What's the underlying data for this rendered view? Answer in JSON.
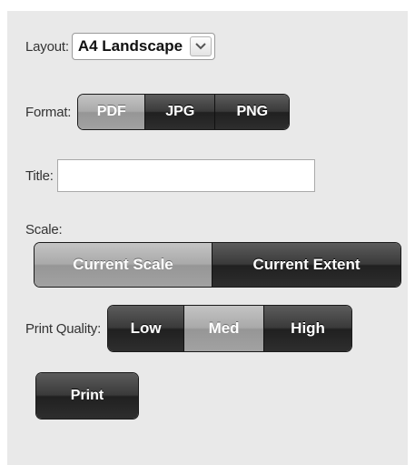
{
  "layout": {
    "label": "Layout:",
    "value": "A4 Landscape",
    "arrow_icon": "chevron-down-icon"
  },
  "format": {
    "label": "Format:",
    "options": [
      "PDF",
      "JPG",
      "PNG"
    ],
    "selected": "PDF"
  },
  "title": {
    "label": "Title:",
    "value": "",
    "placeholder": ""
  },
  "scale": {
    "label": "Scale:",
    "options": [
      "Current Scale",
      "Current Extent"
    ],
    "selected": "Current Scale"
  },
  "quality": {
    "label": "Print Quality:",
    "options": [
      "Low",
      "Med",
      "High"
    ],
    "selected": "Med"
  },
  "print": {
    "label": "Print"
  },
  "colors": {
    "panel_bg": "#e9e9e9",
    "button_dark": "#2e2e2e",
    "button_selected": "#a9a9a9"
  }
}
